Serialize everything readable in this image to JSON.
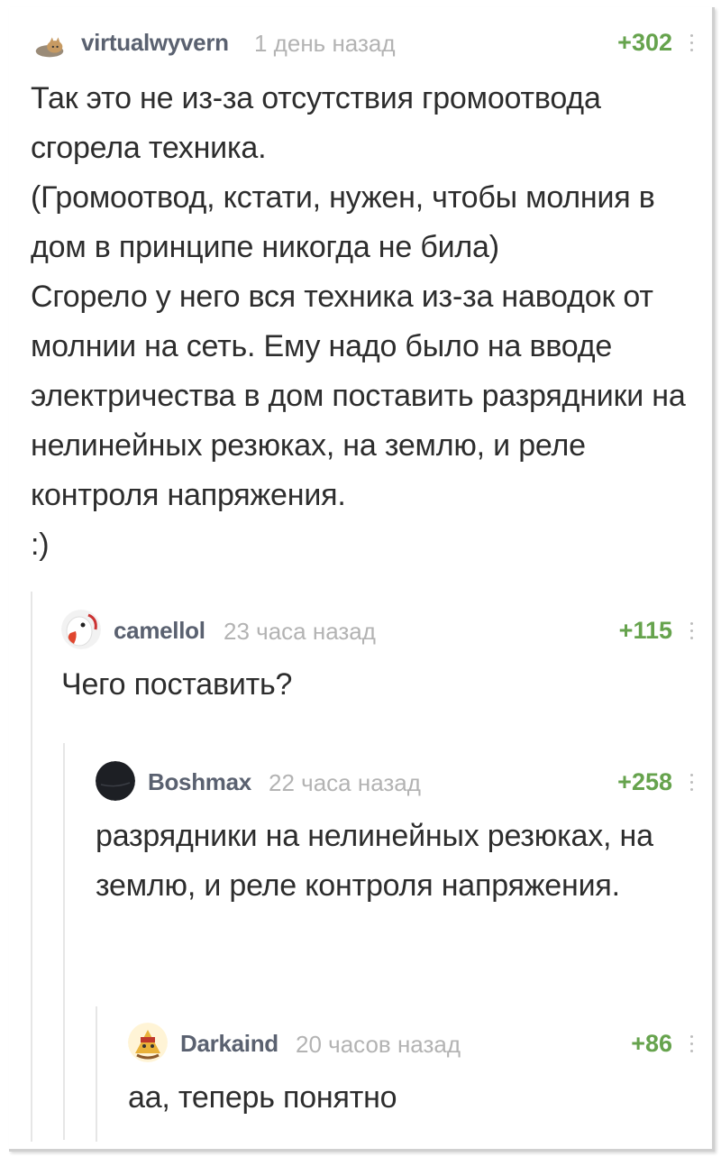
{
  "comments": [
    {
      "username": "virtualwyvern",
      "time": "1 день назад",
      "rating": "+302",
      "avatar": "cat-avatar",
      "text": "Так это не из-за отсутствия громоотвода сгорела техника.\n(Громоотвод, кстати, нужен, чтобы молния в дом в принципе никогда не била)\nСгорело у него вся техника из-за наводок от молнии на сеть. Ему надо было на вводе электричества в дом поставить разрядники на нелинейных резюках, на землю, и реле контроля напряжения.\n:)"
    },
    {
      "username": "camellol",
      "time": "23 часа назад",
      "rating": "+115",
      "avatar": "goose-avatar",
      "text": "Чего поставить?"
    },
    {
      "username": "Boshmax",
      "time": "22 часа назад",
      "rating": "+258",
      "avatar": "dark-circle-avatar",
      "text": "разрядники на нелинейных резюках, на землю, и реле контроля напряжения."
    },
    {
      "username": "Darkaind",
      "time": "20 часов назад",
      "rating": "+86",
      "avatar": "character-avatar",
      "text": "аа, теперь понятно"
    }
  ],
  "colors": {
    "rating": "#66a34d",
    "username": "#5a6170",
    "time": "#b3b3b3",
    "text": "#2d2d2d",
    "thread_line": "#e6e6e6"
  }
}
